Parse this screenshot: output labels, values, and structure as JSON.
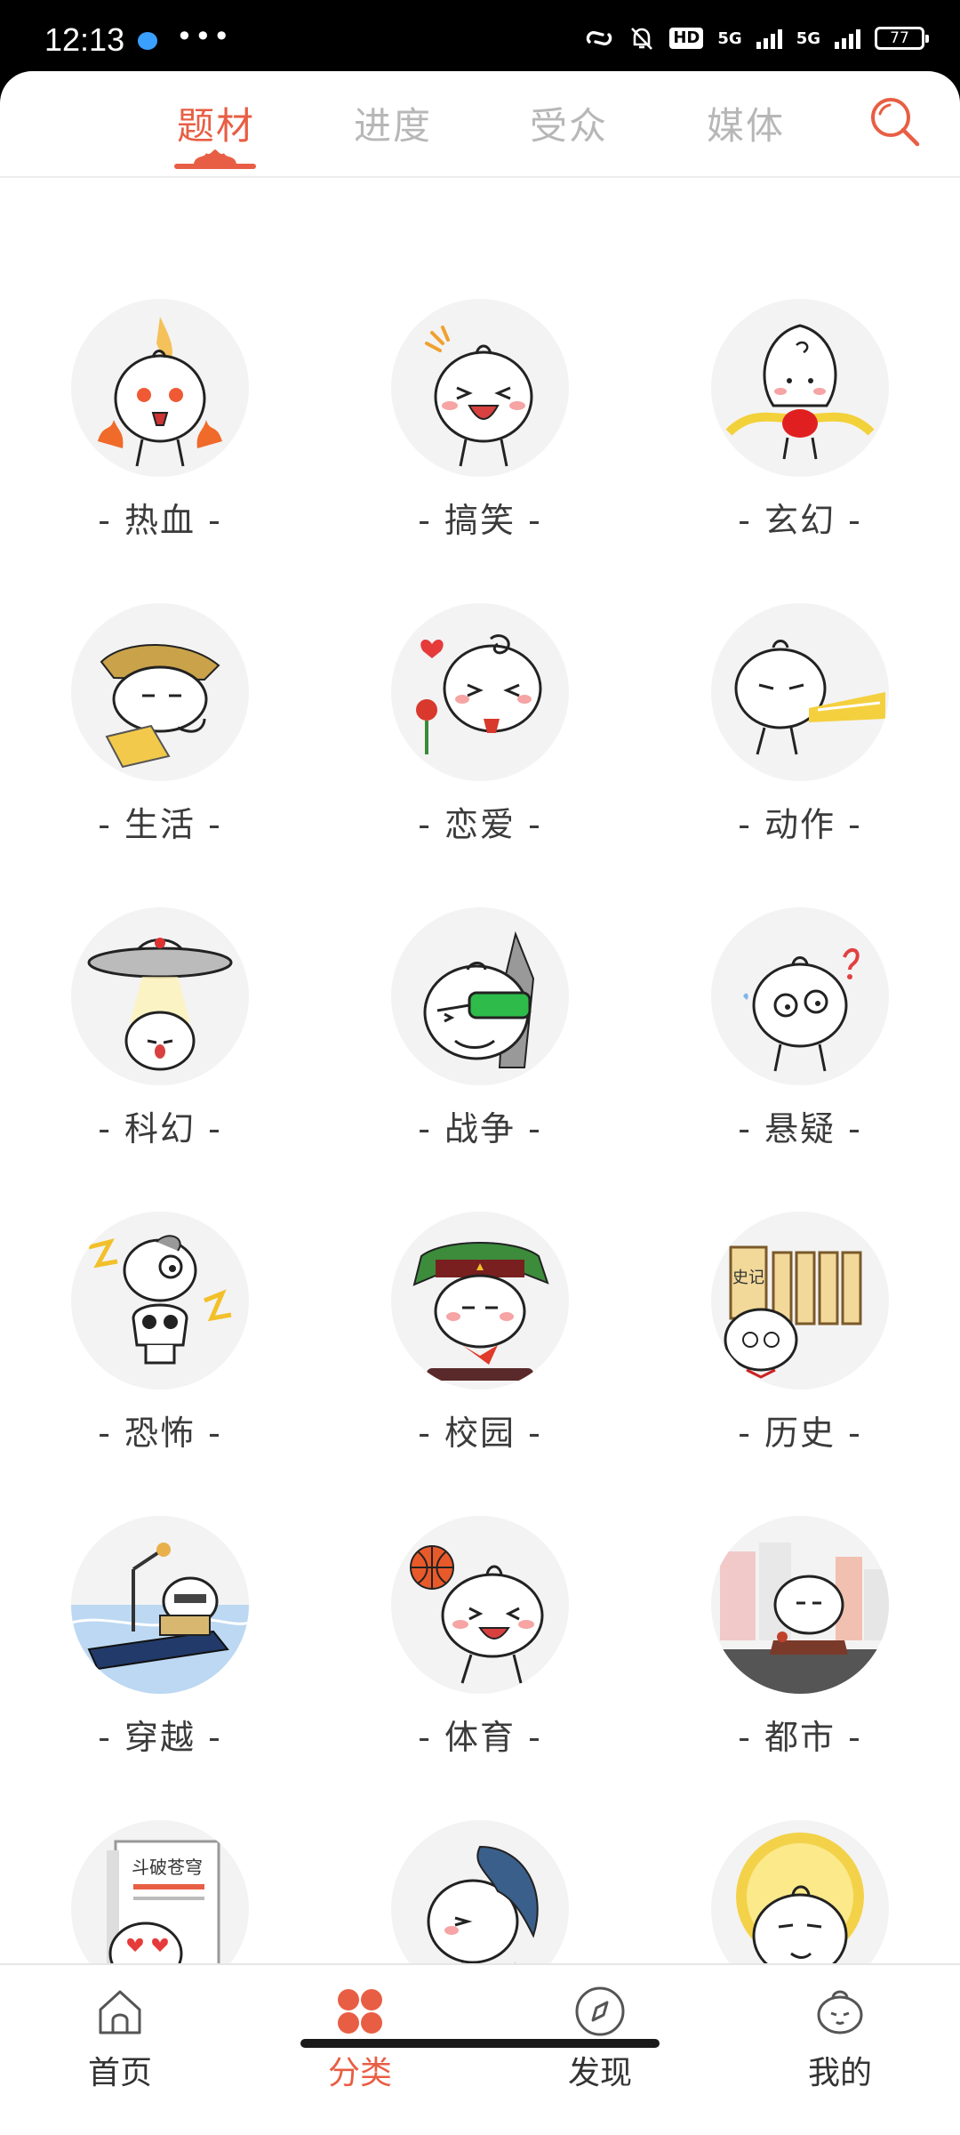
{
  "status_bar": {
    "time": "12:13",
    "hd_label": "HD",
    "network_1": "5G",
    "network_2": "5G",
    "battery": "77"
  },
  "top_tabs": [
    {
      "label": "题材",
      "active": true
    },
    {
      "label": "进度",
      "active": false
    },
    {
      "label": "受众",
      "active": false
    },
    {
      "label": "媒体",
      "active": false
    }
  ],
  "categories": [
    {
      "label": "- 热血 -",
      "icon": "hot-blood-icon"
    },
    {
      "label": "- 搞笑 -",
      "icon": "funny-icon"
    },
    {
      "label": "- 玄幻 -",
      "icon": "fantasy-icon"
    },
    {
      "label": "- 生活 -",
      "icon": "life-icon"
    },
    {
      "label": "- 恋爱 -",
      "icon": "romance-icon"
    },
    {
      "label": "- 动作 -",
      "icon": "action-icon"
    },
    {
      "label": "- 科幻 -",
      "icon": "scifi-icon"
    },
    {
      "label": "- 战争 -",
      "icon": "war-icon"
    },
    {
      "label": "- 悬疑 -",
      "icon": "mystery-icon"
    },
    {
      "label": "- 恐怖 -",
      "icon": "horror-icon"
    },
    {
      "label": "- 校园 -",
      "icon": "campus-icon"
    },
    {
      "label": "- 历史 -",
      "icon": "history-icon"
    },
    {
      "label": "- 穿越 -",
      "icon": "time-travel-icon"
    },
    {
      "label": "- 体育 -",
      "icon": "sports-icon"
    },
    {
      "label": "- 都市 -",
      "icon": "urban-icon"
    },
    {
      "label": "",
      "icon": "book-fan-icon",
      "book_text": "斗破苍穹"
    },
    {
      "label": "",
      "icon": "boy-hair-icon"
    },
    {
      "label": "",
      "icon": "halo-icon"
    }
  ],
  "history_scroll_text": "史记",
  "bottom_nav": [
    {
      "label": "首页",
      "icon": "home-icon",
      "active": false
    },
    {
      "label": "分类",
      "icon": "category-icon",
      "active": true
    },
    {
      "label": "发现",
      "icon": "compass-icon",
      "active": false
    },
    {
      "label": "我的",
      "icon": "profile-mascot-icon",
      "active": false
    }
  ],
  "colors": {
    "accent": "#e85e44",
    "tab_inactive": "#b7b7b7",
    "text": "#3b3b3b",
    "avatar_bg": "#f3f3f3"
  }
}
